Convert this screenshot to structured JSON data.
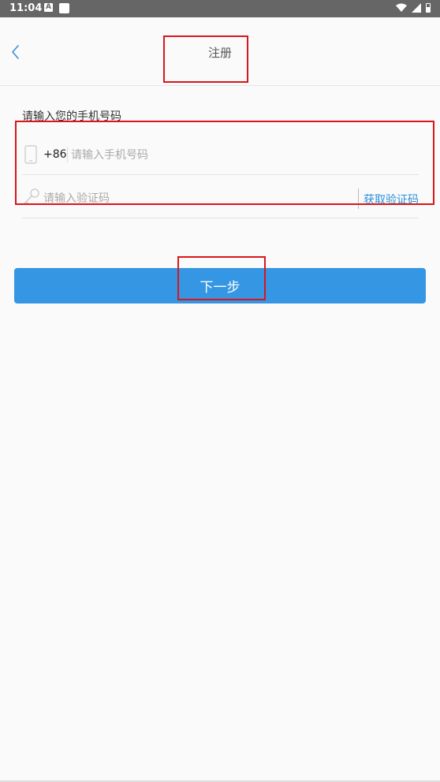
{
  "status_bar": {
    "time": "11:04",
    "notification_icon_letter": "A",
    "icons": [
      "a-notification-icon",
      "square-notification-icon",
      "wifi-icon",
      "signal-icon",
      "battery-icon"
    ]
  },
  "header": {
    "title": "注册",
    "back_icon": "chevron-left-icon"
  },
  "form": {
    "label": "请输入您的手机号码",
    "phone": {
      "icon": "phone-icon",
      "country_code": "+86",
      "placeholder": "请输入手机号码",
      "value": ""
    },
    "code": {
      "icon": "key-icon",
      "placeholder": "请输入验证码",
      "value": "",
      "get_code_label": "获取验证码"
    }
  },
  "next_button": {
    "label": "下一步"
  },
  "colors": {
    "primary": "#3596e3",
    "link": "#2a8fd6",
    "status_bar": "#666666",
    "background": "#fafafa",
    "highlight_box": "#d9161b"
  }
}
